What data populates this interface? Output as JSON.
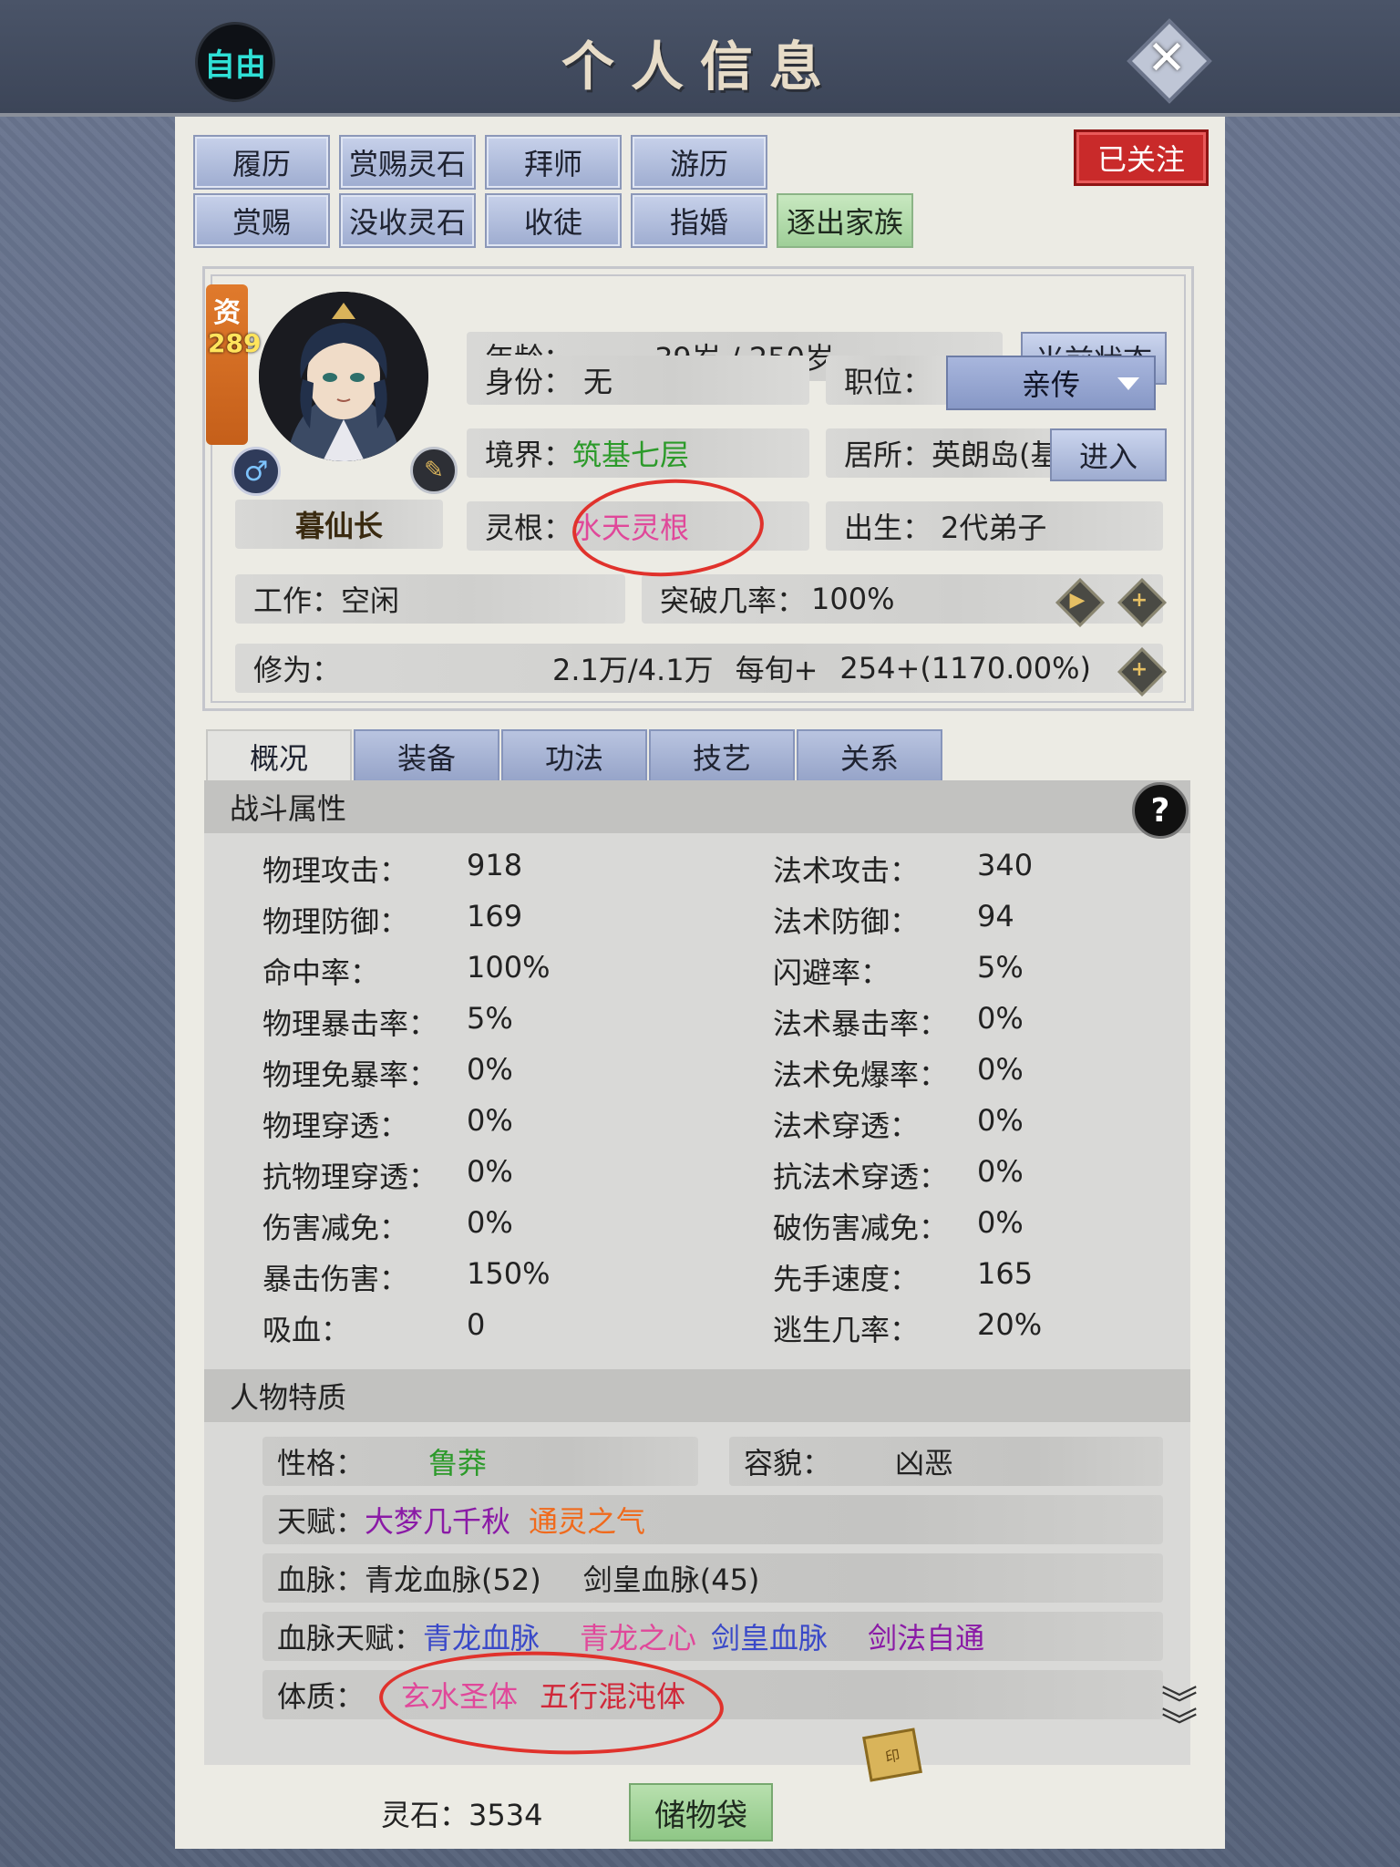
{
  "topbar": {
    "free_label": "自由",
    "title": "个人信息"
  },
  "actions": {
    "row1": [
      "履历",
      "赏赐灵石",
      "拜师",
      "游历"
    ],
    "row2": [
      "赏赐",
      "没收灵石",
      "收徒",
      "指婚"
    ],
    "expel": "逐出家族",
    "followed": "已关注"
  },
  "profile": {
    "aptitude_label": "资",
    "aptitude_value": "289",
    "name": "暮仙长",
    "gender_icon": "♂",
    "age_label": "年龄：",
    "age_value": "39岁 / 250岁",
    "state_button": "当前状态",
    "identity_label": "身份：",
    "identity_value": "无",
    "position_label": "职位：",
    "position_value": "亲传",
    "realm_label": "境界：",
    "realm_value": "筑基七层",
    "residence_label": "居所：",
    "residence_value": "英朗岛(基",
    "enter_button": "进入",
    "root_label": "灵根：",
    "root_value": "水天灵根",
    "birth_label": "出生：",
    "birth_value": "2代弟子",
    "work_label": "工作：",
    "work_value": "空闲",
    "breakthrough_label": "突破几率：",
    "breakthrough_value": "100%",
    "cultivation_label": "修为：",
    "cultivation_value": "2.1万/4.1万",
    "per_period_label": "每旬+",
    "per_period_value": "254+(1170.00%)"
  },
  "tabs": [
    "概况",
    "装备",
    "功法",
    "技艺",
    "关系"
  ],
  "combat": {
    "header": "战斗属性",
    "help": "?",
    "left": [
      {
        "label": "物理攻击：",
        "value": "918"
      },
      {
        "label": "物理防御：",
        "value": "169"
      },
      {
        "label": "命中率：",
        "value": "100%"
      },
      {
        "label": "物理暴击率：",
        "value": "5%"
      },
      {
        "label": "物理免暴率：",
        "value": "0%"
      },
      {
        "label": "物理穿透：",
        "value": "0%"
      },
      {
        "label": "抗物理穿透：",
        "value": "0%"
      },
      {
        "label": "伤害减免：",
        "value": "0%"
      },
      {
        "label": "暴击伤害：",
        "value": "150%"
      },
      {
        "label": "吸血：",
        "value": "0"
      }
    ],
    "right": [
      {
        "label": "法术攻击：",
        "value": "340"
      },
      {
        "label": "法术防御：",
        "value": "94"
      },
      {
        "label": "闪避率：",
        "value": "5%"
      },
      {
        "label": "法术暴击率：",
        "value": "0%"
      },
      {
        "label": "法术免爆率：",
        "value": "0%"
      },
      {
        "label": "法术穿透：",
        "value": "0%"
      },
      {
        "label": "抗法术穿透：",
        "value": "0%"
      },
      {
        "label": "破伤害减免：",
        "value": "0%"
      },
      {
        "label": "先手速度：",
        "value": "165"
      },
      {
        "label": "逃生几率：",
        "value": "20%"
      }
    ]
  },
  "traits": {
    "header": "人物特质",
    "personality_label": "性格：",
    "personality_value": "鲁莽",
    "looks_label": "容貌：",
    "looks_value": "凶恶",
    "talent_label": "天赋：",
    "talent_1": "大梦几千秋",
    "talent_2": "通灵之气",
    "bloodline_label": "血脉：",
    "bloodline_1": "青龙血脉(52)",
    "bloodline_2": "剑皇血脉(45)",
    "bloodtalent_label": "血脉天赋：",
    "bloodtalent_1": "青龙血脉",
    "bloodtalent_2": "青龙之心",
    "bloodtalent_3": "剑皇血脉",
    "bloodtalent_4": "剑法自通",
    "physique_label": "体质：",
    "physique_1": "玄水圣体",
    "physique_2": "五行混沌体"
  },
  "footer": {
    "stones_label": "灵石：",
    "stones_value": "3534",
    "bag_button": "储物袋"
  },
  "colors": {
    "green": "#2c9a2a",
    "pink": "#e0489a",
    "purple": "#8a1aa6",
    "orange": "#f06a1c",
    "blue": "#3a49c8",
    "red_mark": "#e0322c"
  }
}
